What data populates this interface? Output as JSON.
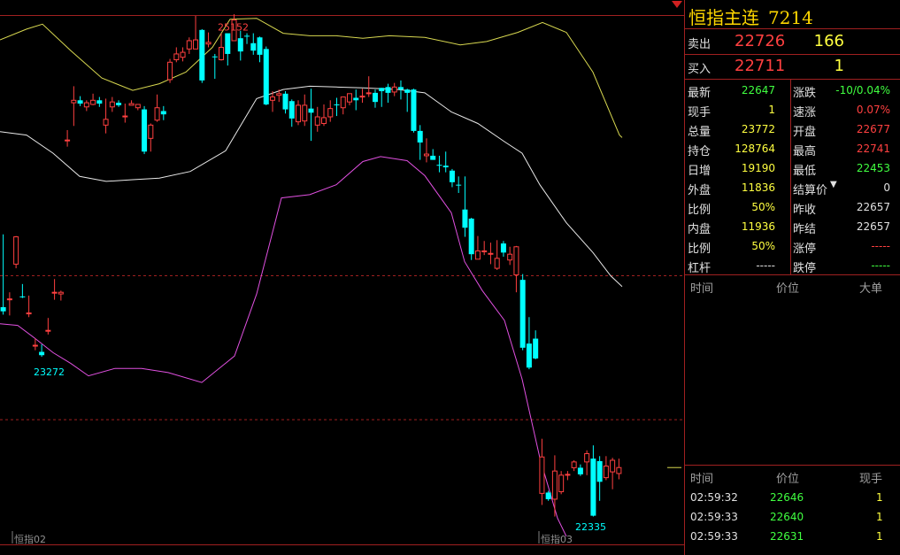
{
  "chart_data": {
    "type": "candlestick",
    "y_range": [
      22180,
      25330
    ],
    "reference_lines": [
      23755,
      22885
    ],
    "max_label": {
      "value": 25152,
      "text": "25152"
    },
    "min_label_left": {
      "value": 23272,
      "text": "23272"
    },
    "min_label_right": {
      "value": 22335,
      "text": "22335"
    },
    "contract_labels": [
      "恒指02",
      "恒指03"
    ],
    "candles": [
      [
        23565,
        23540,
        24005,
        23520
      ],
      [
        23615,
        23615,
        23655,
        23515
      ],
      [
        23825,
        23990,
        23995,
        23800
      ],
      [
        23630,
        23625,
        23705,
        23620
      ],
      [
        23525,
        23530,
        23635,
        23505
      ],
      [
        23335,
        23335,
        23375,
        23305
      ],
      [
        23295,
        23275,
        23340,
        23265
      ],
      [
        23425,
        23425,
        23500,
        23400
      ],
      [
        23655,
        23655,
        23735,
        23610
      ],
      [
        23645,
        23655,
        23665,
        23605
      ],
      [
        24575,
        24575,
        24635,
        24535
      ],
      [
        24800,
        24815,
        24900,
        24660
      ],
      [
        24815,
        24795,
        24840,
        24780
      ],
      [
        24775,
        24800,
        24815,
        24750
      ],
      [
        24790,
        24815,
        24855,
        24785
      ],
      [
        24815,
        24795,
        24835,
        24775
      ],
      [
        24665,
        24700,
        24825,
        24615
      ],
      [
        24775,
        24805,
        24835,
        24745
      ],
      [
        24800,
        24785,
        24815,
        24775
      ],
      [
        24715,
        24720,
        24795,
        24680
      ],
      [
        24785,
        24795,
        24815,
        24785
      ],
      [
        24770,
        24790,
        24790,
        24755
      ],
      [
        24760,
        24505,
        24780,
        24490
      ],
      [
        24585,
        24665,
        24675,
        24505
      ],
      [
        24695,
        24770,
        24850,
        24685
      ],
      [
        24750,
        24730,
        24780,
        24695
      ],
      [
        24940,
        25045,
        25065,
        24920
      ],
      [
        25060,
        25095,
        25135,
        25045
      ],
      [
        25075,
        25105,
        25135,
        25050
      ],
      [
        25125,
        25175,
        25195,
        25095
      ],
      [
        25125,
        25180,
        25325,
        25125
      ],
      [
        25240,
        24935,
        25245,
        24920
      ],
      [
        25155,
        25165,
        25225,
        25135
      ],
      [
        25080,
        25075,
        25095,
        24945
      ],
      [
        25060,
        25135,
        25220,
        25055
      ],
      [
        25220,
        25095,
        25215,
        25025
      ],
      [
        25175,
        25300,
        25335,
        25175
      ],
      [
        25190,
        25110,
        25235,
        25055
      ],
      [
        25205,
        25200,
        25220,
        25155
      ],
      [
        25160,
        25115,
        25220,
        25090
      ],
      [
        25195,
        25090,
        25200,
        25045
      ],
      [
        25125,
        24790,
        25140,
        24785
      ],
      [
        24815,
        24835,
        24870,
        24745
      ],
      [
        24845,
        24855,
        24880,
        24805
      ],
      [
        24855,
        24760,
        24870,
        24735
      ],
      [
        24810,
        24705,
        24820,
        24655
      ],
      [
        24685,
        24785,
        24815,
        24665
      ],
      [
        24690,
        24785,
        24850,
        24660
      ],
      [
        24765,
        24740,
        24885,
        24570
      ],
      [
        24665,
        24715,
        24775,
        24625
      ],
      [
        24675,
        24710,
        24790,
        24660
      ],
      [
        24715,
        24765,
        24815,
        24685
      ],
      [
        24790,
        24785,
        24830,
        24720
      ],
      [
        24770,
        24835,
        24835,
        24730
      ],
      [
        24805,
        24855,
        24855,
        24785
      ],
      [
        24830,
        24815,
        24880,
        24755
      ],
      [
        24840,
        24840,
        24885,
        24800
      ],
      [
        24860,
        24860,
        24960,
        24835
      ],
      [
        24860,
        24805,
        24880,
        24770
      ],
      [
        24890,
        24870,
        24890,
        24775
      ],
      [
        24895,
        24860,
        24915,
        24800
      ],
      [
        24865,
        24895,
        24920,
        24840
      ],
      [
        24895,
        24880,
        24935,
        24820
      ],
      [
        24880,
        24860,
        24885,
        24745
      ],
      [
        24880,
        24630,
        24885,
        24620
      ],
      [
        24630,
        24560,
        24665,
        24455
      ],
      [
        24480,
        24490,
        24585,
        24440
      ],
      [
        24480,
        24455,
        24520,
        24455
      ],
      [
        24425,
        24420,
        24480,
        24380
      ],
      [
        24420,
        24410,
        24505,
        24380
      ],
      [
        24390,
        24320,
        24400,
        24290
      ],
      [
        24305,
        24300,
        24355,
        24255
      ],
      [
        24155,
        24045,
        24355,
        23990
      ],
      [
        24100,
        23885,
        24105,
        23850
      ],
      [
        23855,
        23905,
        23995,
        23865
      ],
      [
        23900,
        23905,
        23965,
        23880
      ],
      [
        23890,
        23890,
        23955,
        23825
      ],
      [
        23800,
        23860,
        23970,
        23790
      ],
      [
        23950,
        23895,
        23965,
        23870
      ],
      [
        23850,
        23885,
        23930,
        23820
      ],
      [
        23760,
        23930,
        23935,
        23655
      ],
      [
        23730,
        23320,
        23765,
        23305
      ],
      [
        23345,
        23200,
        23505,
        23190
      ],
      [
        23375,
        23255,
        23425,
        23250
      ],
      [
        22440,
        22660,
        22770,
        22370
      ],
      [
        22445,
        22405,
        22455,
        22395
      ],
      [
        22405,
        22575,
        22670,
        22300
      ],
      [
        22450,
        22550,
        22575,
        22435
      ],
      [
        22550,
        22555,
        22575,
        22520
      ],
      [
        22595,
        22630,
        22640,
        22575
      ],
      [
        22595,
        22555,
        22615,
        22545
      ],
      [
        22630,
        22680,
        22700,
        22550
      ],
      [
        22650,
        22305,
        22730,
        22300
      ],
      [
        22635,
        22510,
        22665,
        22395
      ],
      [
        22535,
        22605,
        22665,
        22520
      ],
      [
        22570,
        22640,
        22655,
        22465
      ],
      [
        22560,
        22596,
        22650,
        22525
      ]
    ],
    "bands": [
      {
        "name": "upper",
        "color": "#d8d850",
        "points": [
          [
            0,
            25180
          ],
          [
            30,
            25245
          ],
          [
            48,
            25275
          ],
          [
            80,
            25115
          ],
          [
            115,
            24950
          ],
          [
            150,
            24875
          ],
          [
            180,
            24915
          ],
          [
            210,
            24985
          ],
          [
            240,
            25135
          ],
          [
            260,
            25305
          ],
          [
            290,
            25310
          ],
          [
            320,
            25220
          ],
          [
            350,
            25205
          ],
          [
            380,
            25205
          ],
          [
            410,
            25190
          ],
          [
            440,
            25205
          ],
          [
            480,
            25195
          ],
          [
            520,
            25150
          ],
          [
            550,
            25170
          ],
          [
            585,
            25225
          ],
          [
            613,
            25285
          ],
          [
            640,
            25225
          ],
          [
            670,
            24985
          ],
          [
            700,
            24605
          ],
          [
            703,
            24590
          ]
        ]
      },
      {
        "name": "middle",
        "color": "#e8e8e8",
        "points": [
          [
            0,
            24625
          ],
          [
            30,
            24605
          ],
          [
            60,
            24495
          ],
          [
            90,
            24355
          ],
          [
            120,
            24325
          ],
          [
            150,
            24335
          ],
          [
            180,
            24345
          ],
          [
            215,
            24385
          ],
          [
            255,
            24510
          ],
          [
            290,
            24825
          ],
          [
            320,
            24880
          ],
          [
            350,
            24900
          ],
          [
            380,
            24895
          ],
          [
            410,
            24890
          ],
          [
            450,
            24880
          ],
          [
            480,
            24860
          ],
          [
            510,
            24745
          ],
          [
            540,
            24675
          ],
          [
            570,
            24565
          ],
          [
            590,
            24495
          ],
          [
            610,
            24305
          ],
          [
            640,
            24075
          ],
          [
            670,
            23895
          ],
          [
            690,
            23755
          ],
          [
            703,
            23690
          ]
        ]
      },
      {
        "name": "lower",
        "color": "#e050e0",
        "points": [
          [
            0,
            23465
          ],
          [
            20,
            23455
          ],
          [
            40,
            23375
          ],
          [
            60,
            23290
          ],
          [
            80,
            23225
          ],
          [
            100,
            23150
          ],
          [
            130,
            23195
          ],
          [
            160,
            23195
          ],
          [
            190,
            23170
          ],
          [
            228,
            23110
          ],
          [
            265,
            23270
          ],
          [
            290,
            23645
          ],
          [
            318,
            24225
          ],
          [
            350,
            24245
          ],
          [
            380,
            24305
          ],
          [
            410,
            24445
          ],
          [
            430,
            24475
          ],
          [
            460,
            24450
          ],
          [
            480,
            24360
          ],
          [
            510,
            24135
          ],
          [
            525,
            23840
          ],
          [
            545,
            23665
          ],
          [
            570,
            23485
          ],
          [
            590,
            23130
          ],
          [
            610,
            22655
          ],
          [
            630,
            22290
          ],
          [
            640,
            22180
          ]
        ]
      }
    ]
  },
  "quote": {
    "name": "恒指主连",
    "code": "7214",
    "sell_label": "卖出",
    "sell_price": "22726",
    "sell_vol": "166",
    "buy_label": "买入",
    "buy_price": "22711",
    "buy_vol": "1",
    "stats_left": [
      {
        "label": "最新",
        "value": "22647",
        "color": "#40ff40"
      },
      {
        "label": "现手",
        "value": "1",
        "color": "#ffff40"
      },
      {
        "label": "总量",
        "value": "23772",
        "color": "#ffff40"
      },
      {
        "label": "持仓",
        "value": "128764",
        "color": "#ffff40"
      },
      {
        "label": "日增",
        "value": "19190",
        "color": "#ffff40"
      },
      {
        "label": "外盘",
        "value": "11836",
        "color": "#ffff40"
      },
      {
        "label": "比例",
        "value": "50%",
        "color": "#ffff40"
      },
      {
        "label": "内盘",
        "value": "11936",
        "color": "#ffff40"
      },
      {
        "label": "比例",
        "value": "50%",
        "color": "#ffff40"
      },
      {
        "label": "杠杆",
        "value": "-----",
        "color": "#e0e0e0"
      }
    ],
    "stats_right": [
      {
        "label": "涨跌",
        "value": "-10/0.04%",
        "color": "#40ff40"
      },
      {
        "label": "速涨",
        "value": "0.07%",
        "color": "#ff4040"
      },
      {
        "label": "开盘",
        "value": "22677",
        "color": "#ff4040"
      },
      {
        "label": "最高",
        "value": "22741",
        "color": "#ff4040"
      },
      {
        "label": "最低",
        "value": "22453",
        "color": "#40ff40"
      },
      {
        "label": "结算价",
        "value": "0",
        "color": "#e0e0e0"
      },
      {
        "label": "昨收",
        "value": "22657",
        "color": "#e0e0e0"
      },
      {
        "label": "昨结",
        "value": "22657",
        "color": "#e0e0e0"
      },
      {
        "label": "涨停",
        "value": "-----",
        "color": "#ff4040"
      },
      {
        "label": "跌停",
        "value": "-----",
        "color": "#40ff40"
      }
    ],
    "detail_headers": {
      "time": "时间",
      "price": "价位",
      "big": "大单"
    },
    "ticks_headers": {
      "time": "时间",
      "price": "价位",
      "vol": "现手"
    },
    "ticks": [
      {
        "time": "02:59:32",
        "price": "22646",
        "vol": "1"
      },
      {
        "time": "02:59:33",
        "price": "22640",
        "vol": "1"
      },
      {
        "time": "02:59:33",
        "price": "22631",
        "vol": "1"
      }
    ]
  }
}
